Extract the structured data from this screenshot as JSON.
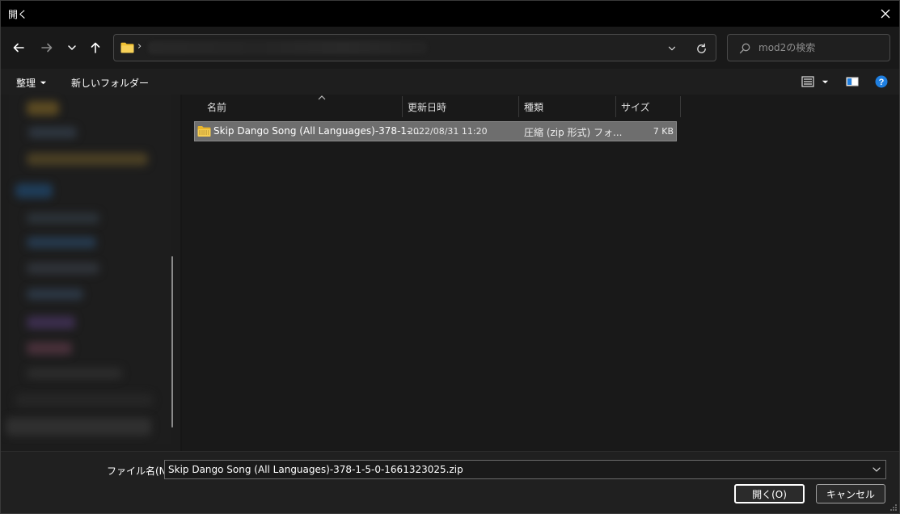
{
  "window": {
    "title": "開く"
  },
  "nav": {
    "back_icon": "arrow-left-icon",
    "forward_icon": "arrow-right-icon",
    "recent_icon": "chevron-down-icon",
    "up_icon": "arrow-up-icon",
    "address_separator": "›",
    "refresh_icon": "refresh-icon"
  },
  "search": {
    "placeholder": "mod2の検索"
  },
  "toolbar": {
    "organize_label": "整理",
    "new_folder_label": "新しいフォルダー"
  },
  "columns": [
    {
      "label": "名前"
    },
    {
      "label": "更新日時"
    },
    {
      "label": "種類"
    },
    {
      "label": "サイズ"
    }
  ],
  "files": [
    {
      "name": "Skip Dango Song (All Languages)-378-1-...",
      "modified": "2022/08/31 11:20",
      "type": "圧縮 (zip 形式) フォ...",
      "size": "7 KB",
      "selected": true
    }
  ],
  "footer": {
    "filename_label": "ファイル名(N):",
    "filename_value": "Skip Dango Song (All Languages)-378-1-5-0-1661323025.zip",
    "open_label": "開く(O)",
    "cancel_label": "キャンセル"
  },
  "colors": {
    "titlebar": "#000000",
    "selection": "#6e6e6e",
    "help_blue": "#1f7fe0",
    "folder_yellow": "#f2c233"
  }
}
